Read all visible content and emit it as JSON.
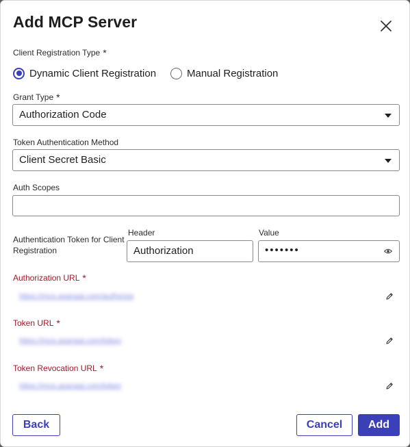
{
  "dialog": {
    "title": "Add MCP Server",
    "close_icon": "close-icon"
  },
  "client_registration": {
    "label": "Client Registration Type",
    "required_mark": "*",
    "options": [
      {
        "label": "Dynamic Client Registration",
        "selected": true
      },
      {
        "label": "Manual Registration",
        "selected": false
      }
    ]
  },
  "grant_type": {
    "label": "Grant Type",
    "required_mark": "*",
    "value": "Authorization Code"
  },
  "token_auth_method": {
    "label": "Token Authentication Method",
    "value": "Client Secret Basic"
  },
  "auth_scopes": {
    "label": "Auth Scopes",
    "value": ""
  },
  "auth_token": {
    "label_line1": "Authentication Token for Client",
    "label_line2": "Registration",
    "header_label": "Header",
    "header_value": "Authorization",
    "value_label": "Value",
    "value_masked": "•••••••",
    "eye_icon": "eye-icon"
  },
  "authorization_url": {
    "label": "Authorization URL",
    "required_mark": "*",
    "value": "https://mcp.asanaai.com/authorize"
  },
  "token_url": {
    "label": "Token URL",
    "required_mark": "*",
    "value": "https://mcp.asanaai.com/token"
  },
  "token_revocation_url": {
    "label": "Token Revocation URL",
    "required_mark": "*",
    "value": "https://mcp.asanaai.com/token"
  },
  "footer": {
    "back_label": "Back",
    "cancel_label": "Cancel",
    "add_label": "Add"
  },
  "colors": {
    "accent": "#3b3fb8",
    "required_red": "#a3172b",
    "link": "#5b63d8"
  }
}
